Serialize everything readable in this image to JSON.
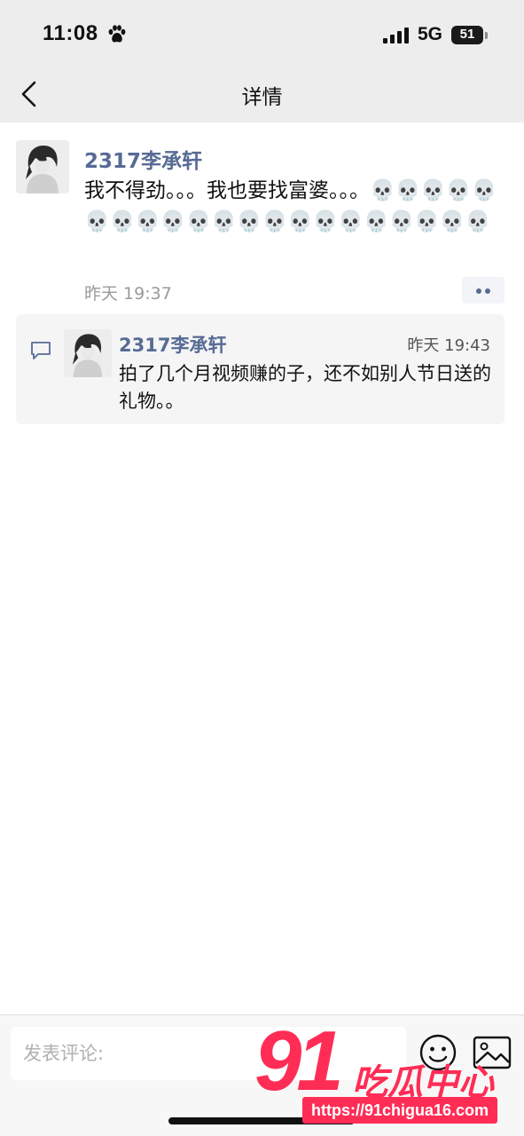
{
  "status_bar": {
    "time": "11:08",
    "network": "5G",
    "battery": "51"
  },
  "nav": {
    "title": "详情"
  },
  "post": {
    "author": "2317李承轩",
    "text": "我不得劲。。。我也要找富婆。。。💀💀💀💀💀💀💀💀💀💀💀💀💀💀💀💀💀💀💀💀💀",
    "time": "昨天 19:37"
  },
  "comment": {
    "author": "2317李承轩",
    "time": "昨天 19:43",
    "text": "拍了几个月视频赚的子，还不如别人节日送的礼物。。"
  },
  "input": {
    "placeholder": "发表评论:"
  },
  "watermark": {
    "number": "91",
    "name": "吃瓜中心",
    "url": "https://91chigua16.com"
  },
  "colors": {
    "link_blue": "#576b95",
    "brand_red": "#ff2d55"
  }
}
